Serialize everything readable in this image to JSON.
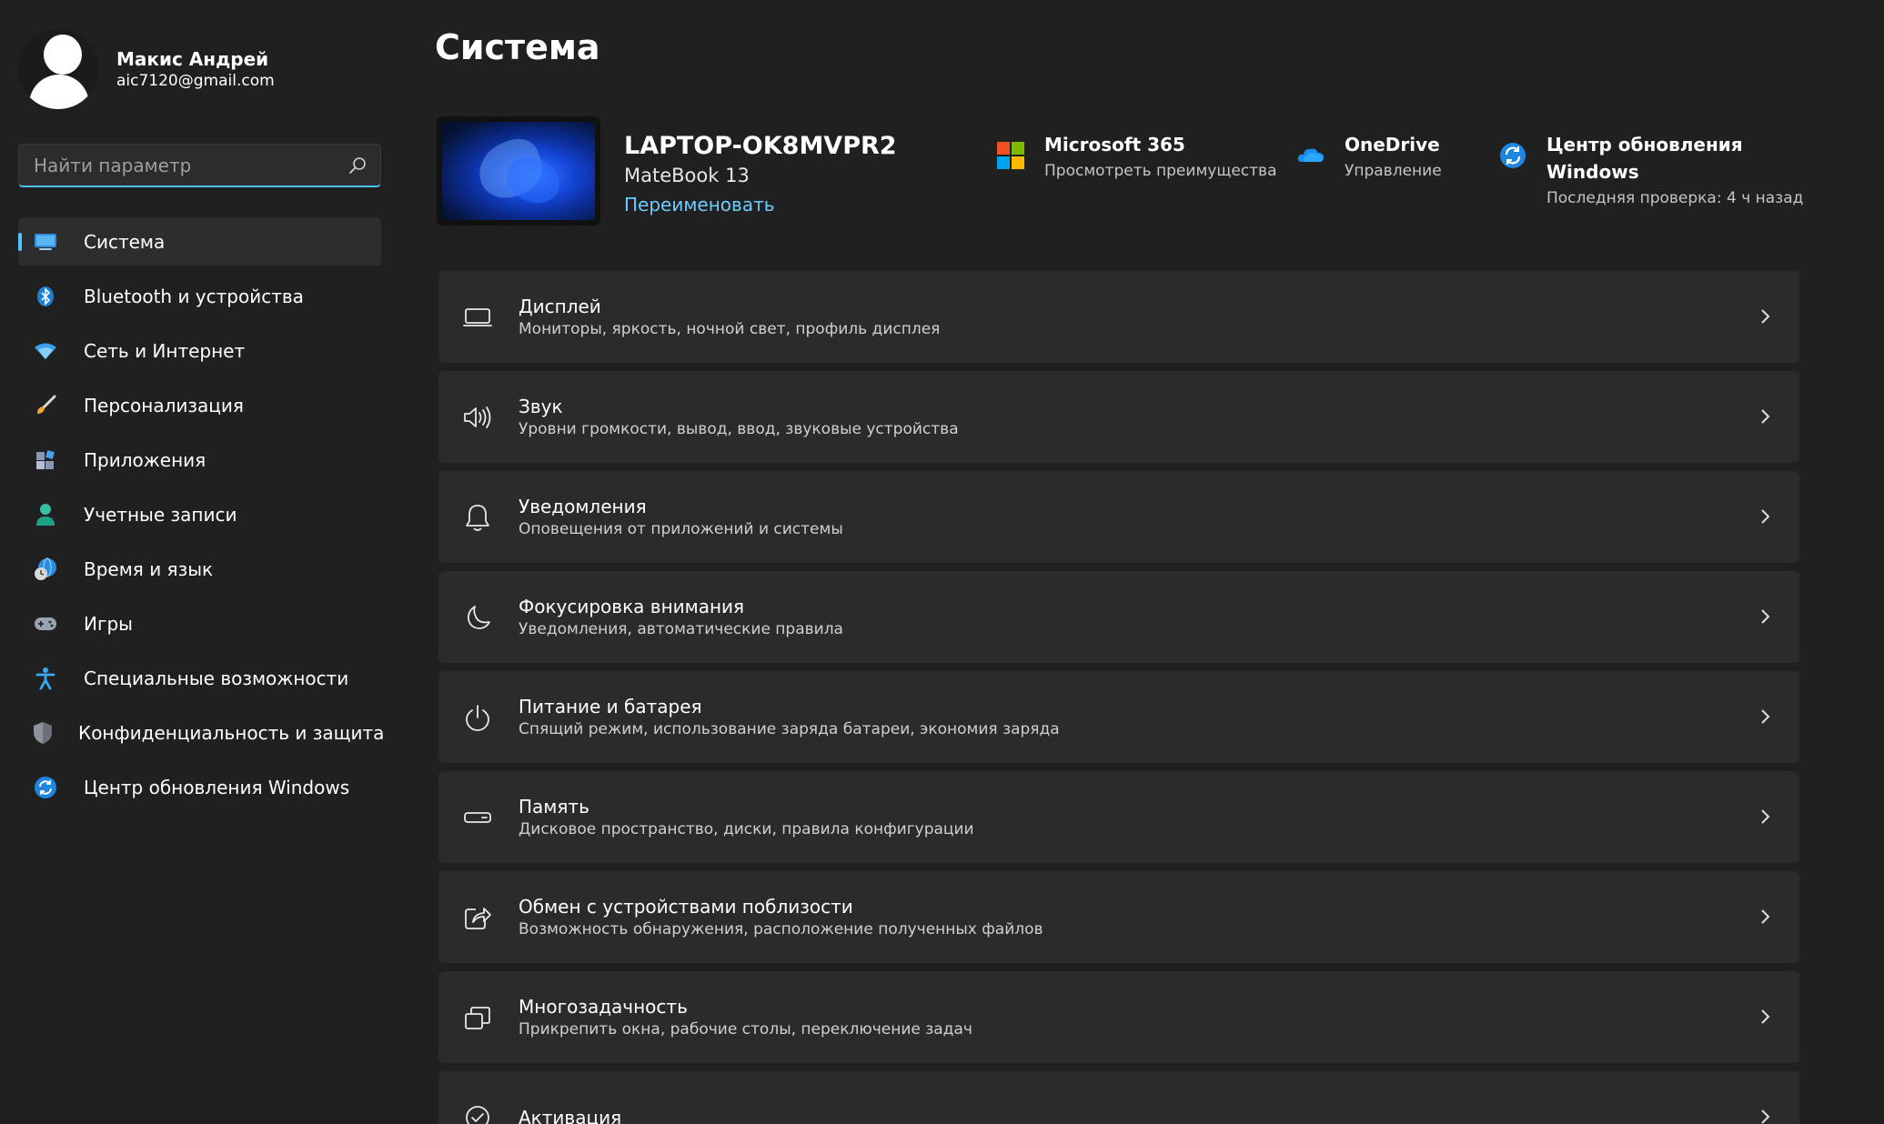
{
  "profile": {
    "name": "Макис Андрей",
    "email": "aic7120@gmail.com"
  },
  "search": {
    "placeholder": "Найти параметр"
  },
  "nav": {
    "items": [
      {
        "label": "Система",
        "icon": "display-icon",
        "active": true
      },
      {
        "label": "Bluetooth и устройства",
        "icon": "bluetooth-icon"
      },
      {
        "label": "Сеть и Интернет",
        "icon": "wifi-icon"
      },
      {
        "label": "Персонализация",
        "icon": "brush-icon"
      },
      {
        "label": "Приложения",
        "icon": "apps-icon"
      },
      {
        "label": "Учетные записи",
        "icon": "account-icon"
      },
      {
        "label": "Время и язык",
        "icon": "time-language-icon"
      },
      {
        "label": "Игры",
        "icon": "gamepad-icon"
      },
      {
        "label": "Специальные возможности",
        "icon": "accessibility-icon"
      },
      {
        "label": "Конфиденциальность и защита",
        "icon": "shield-icon"
      },
      {
        "label": "Центр обновления Windows",
        "icon": "windows-update-icon"
      }
    ]
  },
  "main": {
    "title": "Система",
    "device": {
      "name": "LAPTOP-OK8MVPR2",
      "model": "MateBook 13",
      "rename_label": "Переименовать"
    },
    "quick": {
      "ms365": {
        "title": "Microsoft 365",
        "subtitle": "Просмотреть преимущества"
      },
      "onedrive": {
        "title": "OneDrive",
        "subtitle": "Управление"
      },
      "update": {
        "title": "Центр обновления Windows",
        "subtitle": "Последняя проверка: 4 ч назад"
      }
    },
    "settings": [
      {
        "title": "Дисплей",
        "subtitle": "Мониторы, яркость, ночной свет, профиль дисплея",
        "icon": "monitor-icon"
      },
      {
        "title": "Звук",
        "subtitle": "Уровни громкости, вывод, ввод, звуковые устройства",
        "icon": "speaker-icon"
      },
      {
        "title": "Уведомления",
        "subtitle": "Оповещения от приложений и системы",
        "icon": "bell-icon"
      },
      {
        "title": "Фокусировка внимания",
        "subtitle": "Уведомления, автоматические правила",
        "icon": "moon-icon"
      },
      {
        "title": "Питание и батарея",
        "subtitle": "Спящий режим, использование заряда батареи, экономия заряда",
        "icon": "power-icon"
      },
      {
        "title": "Память",
        "subtitle": "Дисковое пространство, диски, правила конфигурации",
        "icon": "storage-icon"
      },
      {
        "title": "Обмен с устройствами поблизости",
        "subtitle": "Возможность обнаружения, расположение полученных файлов",
        "icon": "share-icon"
      },
      {
        "title": "Многозадачность",
        "subtitle": "Прикрепить окна, рабочие столы, переключение задач",
        "icon": "multitasking-icon"
      },
      {
        "title": "Активация",
        "subtitle": "",
        "icon": "check-circle-icon"
      }
    ]
  },
  "colors": {
    "background": "#202020",
    "card": "#2b2b2b",
    "accent": "#4cc2ff",
    "link": "#6ccbff"
  }
}
